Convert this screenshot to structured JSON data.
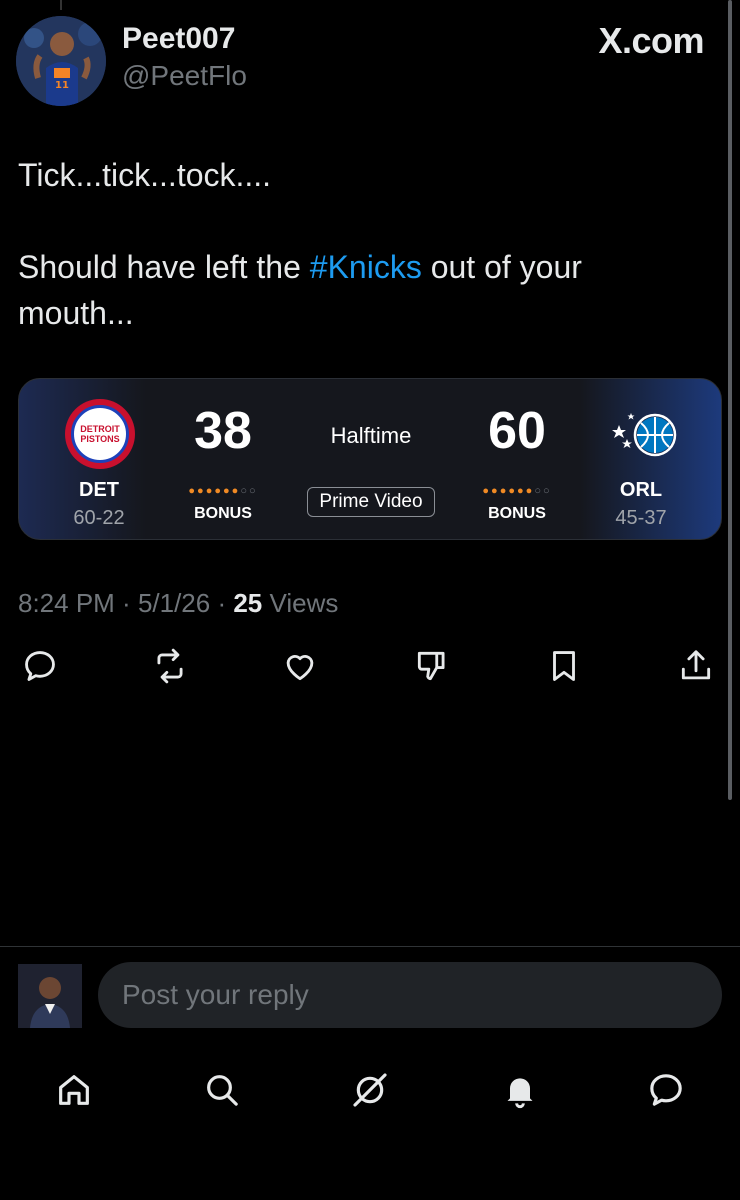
{
  "header": {
    "display_name": "Peet007",
    "handle": "@PeetFlo",
    "brand": "X.com"
  },
  "post": {
    "line1": "Tick...tick...tock....",
    "line2_before": "Should have left the ",
    "hashtag": "#Knicks",
    "line2_after": " out of your",
    "line3": "mouth..."
  },
  "score_card": {
    "status": "Halftime",
    "broadcast": "Prime Video",
    "home": {
      "abbr": "DET",
      "record": "60-22",
      "score": "38",
      "bonus": "BONUS",
      "logo_text_1": "DETROIT",
      "logo_text_2": "PISTONS",
      "fouls_lit": 6,
      "fouls_total": 8
    },
    "away": {
      "abbr": "ORL",
      "record": "45-37",
      "score": "60",
      "bonus": "BONUS",
      "fouls_lit": 6,
      "fouls_total": 8
    },
    "colors": {
      "foul_on": "#f08a24",
      "foul_off": "#6b6f76"
    }
  },
  "meta": {
    "time": "8:24 PM",
    "sep1": " · ",
    "date": "5/1/26",
    "sep2": " · ",
    "views_count": "25",
    "views_label": " Views"
  },
  "actions": {
    "icons": [
      "reply-icon",
      "repost-icon",
      "like-icon",
      "dislike-icon",
      "bookmark-icon",
      "share-icon"
    ]
  },
  "reply": {
    "placeholder": "Post your reply"
  },
  "bottom_nav": {
    "icons": [
      "home-icon",
      "search-icon",
      "grok-icon",
      "notifications-icon",
      "messages-icon"
    ]
  },
  "colors": {
    "background": "#000000",
    "text": "#e7e9ea",
    "muted": "#71767b",
    "link": "#1d9bf0"
  }
}
